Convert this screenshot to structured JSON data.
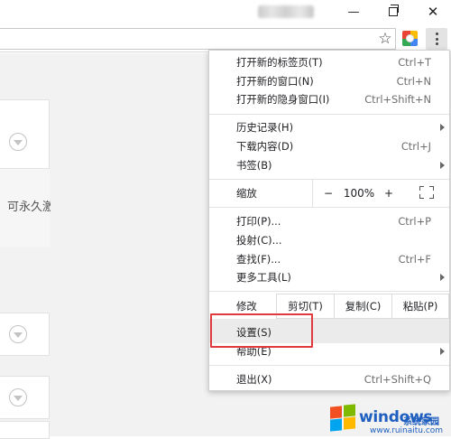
{
  "window": {
    "user_blurred": "",
    "min_glyph": "—",
    "close_glyph": "✕"
  },
  "toolbar": {
    "star_glyph": "☆",
    "extension_icon": "colorful-extension-icon",
    "menu_icon": "three-dot-menu-icon"
  },
  "page": {
    "card_text": "可永久激"
  },
  "menu": {
    "new_tab": {
      "label": "打开新的标签页(T)",
      "shortcut": "Ctrl+T"
    },
    "new_window": {
      "label": "打开新的窗口(N)",
      "shortcut": "Ctrl+N"
    },
    "new_incognito": {
      "label": "打开新的隐身窗口(I)",
      "shortcut": "Ctrl+Shift+N"
    },
    "history": {
      "label": "历史记录(H)"
    },
    "downloads": {
      "label": "下载内容(D)",
      "shortcut": "Ctrl+J"
    },
    "bookmarks": {
      "label": "书签(B)"
    },
    "zoom": {
      "label": "缩放",
      "minus": "−",
      "value": "100%",
      "plus": "+"
    },
    "print": {
      "label": "打印(P)...",
      "shortcut": "Ctrl+P"
    },
    "cast": {
      "label": "投射(C)..."
    },
    "find": {
      "label": "查找(F)...",
      "shortcut": "Ctrl+F"
    },
    "more_tools": {
      "label": "更多工具(L)"
    },
    "edit": {
      "label": "修改",
      "cut": "剪切(T)",
      "copy": "复制(C)",
      "paste": "粘贴(P)"
    },
    "settings": {
      "label": "设置(S)"
    },
    "help": {
      "label": "帮助(E)"
    },
    "exit": {
      "label": "退出(X)",
      "shortcut": "Ctrl+Shift+Q"
    }
  },
  "watermark": {
    "brand": "windows",
    "sub": "系统家园",
    "url": "www.ruinaitu.com"
  },
  "colors": {
    "highlight_box": "#e0393e",
    "watermark": "#1f5fbf"
  }
}
